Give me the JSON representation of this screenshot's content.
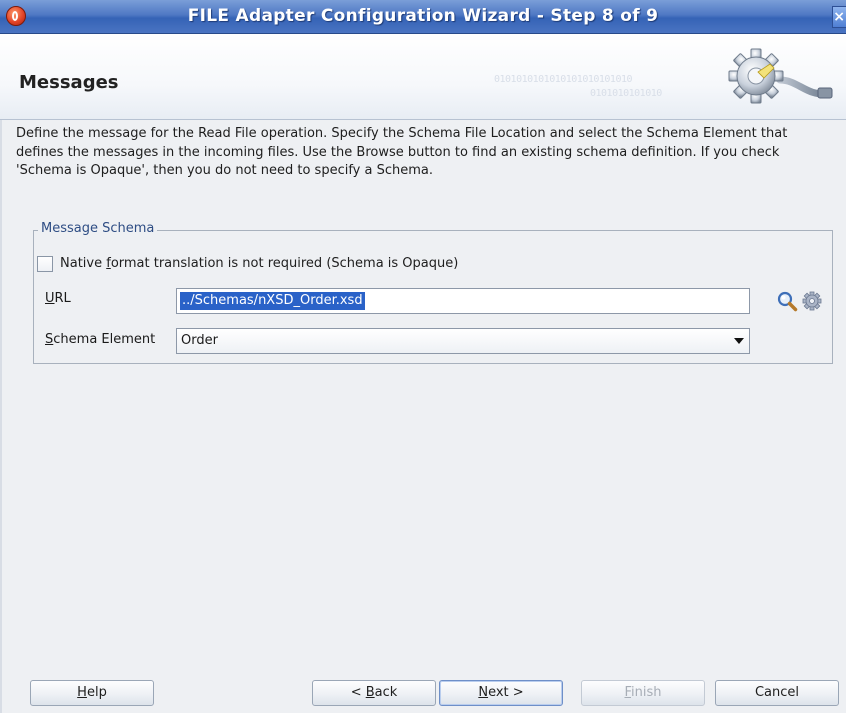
{
  "window": {
    "title": "FILE Adapter Configuration Wizard - Step 8 of 9",
    "close_glyph": "×"
  },
  "header": {
    "title": "Messages",
    "binary_1": "0101010101010101010101010",
    "binary_2": "0101010101010"
  },
  "description": "Define the message for the Read File operation.  Specify the Schema File Location and select the Schema Element that defines the messages in the incoming files. Use the Browse button to find an existing schema definition. If you check 'Schema is Opaque', then you do not need to specify a Schema.",
  "message_schema": {
    "legend": "Message Schema",
    "opaque_checkbox": {
      "checked": false,
      "label_before": "Native ",
      "label_mnemonic": "f",
      "label_after": "ormat translation is not required (Schema is Opaque)"
    },
    "url": {
      "label_mnemonic": "U",
      "label_rest": "RL",
      "value": "../Schemas/nXSD_Order.xsd"
    },
    "schema_element": {
      "label_mnemonic": "S",
      "label_rest": "chema Element",
      "value": "Order"
    },
    "icons": {
      "browse": "search-icon",
      "generate": "gear-icon"
    }
  },
  "buttons": {
    "help": {
      "mnemonic": "H",
      "rest": "elp"
    },
    "back": {
      "prefix": "< ",
      "mnemonic": "B",
      "rest": "ack"
    },
    "next": {
      "mnemonic": "N",
      "rest": "ext >"
    },
    "finish": {
      "mnemonic": "F",
      "rest": "inish",
      "enabled": false
    },
    "cancel": {
      "label": "Cancel"
    }
  },
  "colors": {
    "title_bar": "#4f78c4",
    "selection": "#2a62c8",
    "group_legend": "#2e4d84"
  }
}
